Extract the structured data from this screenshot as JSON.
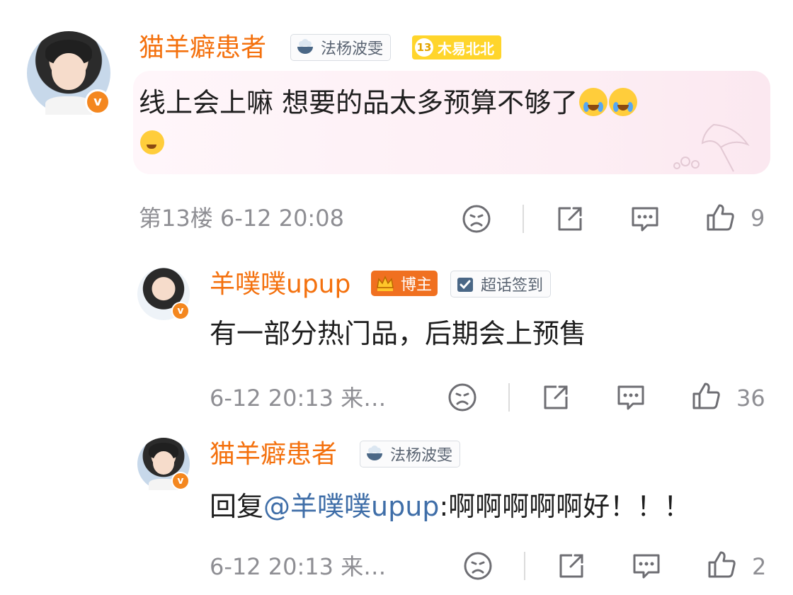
{
  "comments": [
    {
      "user": "猫羊癖患者",
      "tags": [
        {
          "label": "法杨波雯",
          "icon": "rice-bowl-icon"
        }
      ],
      "level": {
        "num": "13",
        "label": "木易北北"
      },
      "text": "线上会上嘛 想要的品太多预算不够了",
      "emojis": [
        "crying-emoji",
        "crying-emoji",
        "sheepish-emoji"
      ],
      "floor": "第13楼",
      "time": "6-12 20:08",
      "likes": "9"
    },
    {
      "user": "羊噗噗upup",
      "tags": [
        {
          "label": "博主",
          "icon": "crown-icon"
        },
        {
          "label": "超话签到",
          "icon": "check-icon"
        }
      ],
      "text": "有一部分热门品，后期会上预售",
      "time": "6-12 20:13",
      "source": "来…",
      "likes": "36"
    },
    {
      "user": "猫羊癖患者",
      "tags": [
        {
          "label": "法杨波雯",
          "icon": "rice-bowl-icon"
        }
      ],
      "reply_prefix": "回复",
      "mention": "@羊噗噗upup",
      "text": ":啊啊啊啊啊好！！！",
      "time": "6-12 20:13",
      "source": "来…",
      "likes": "2"
    }
  ],
  "colors": {
    "name": "#f4710e",
    "mention": "#3f6ea8",
    "meta": "#8e8e93",
    "vbadge": "#f4871f"
  }
}
